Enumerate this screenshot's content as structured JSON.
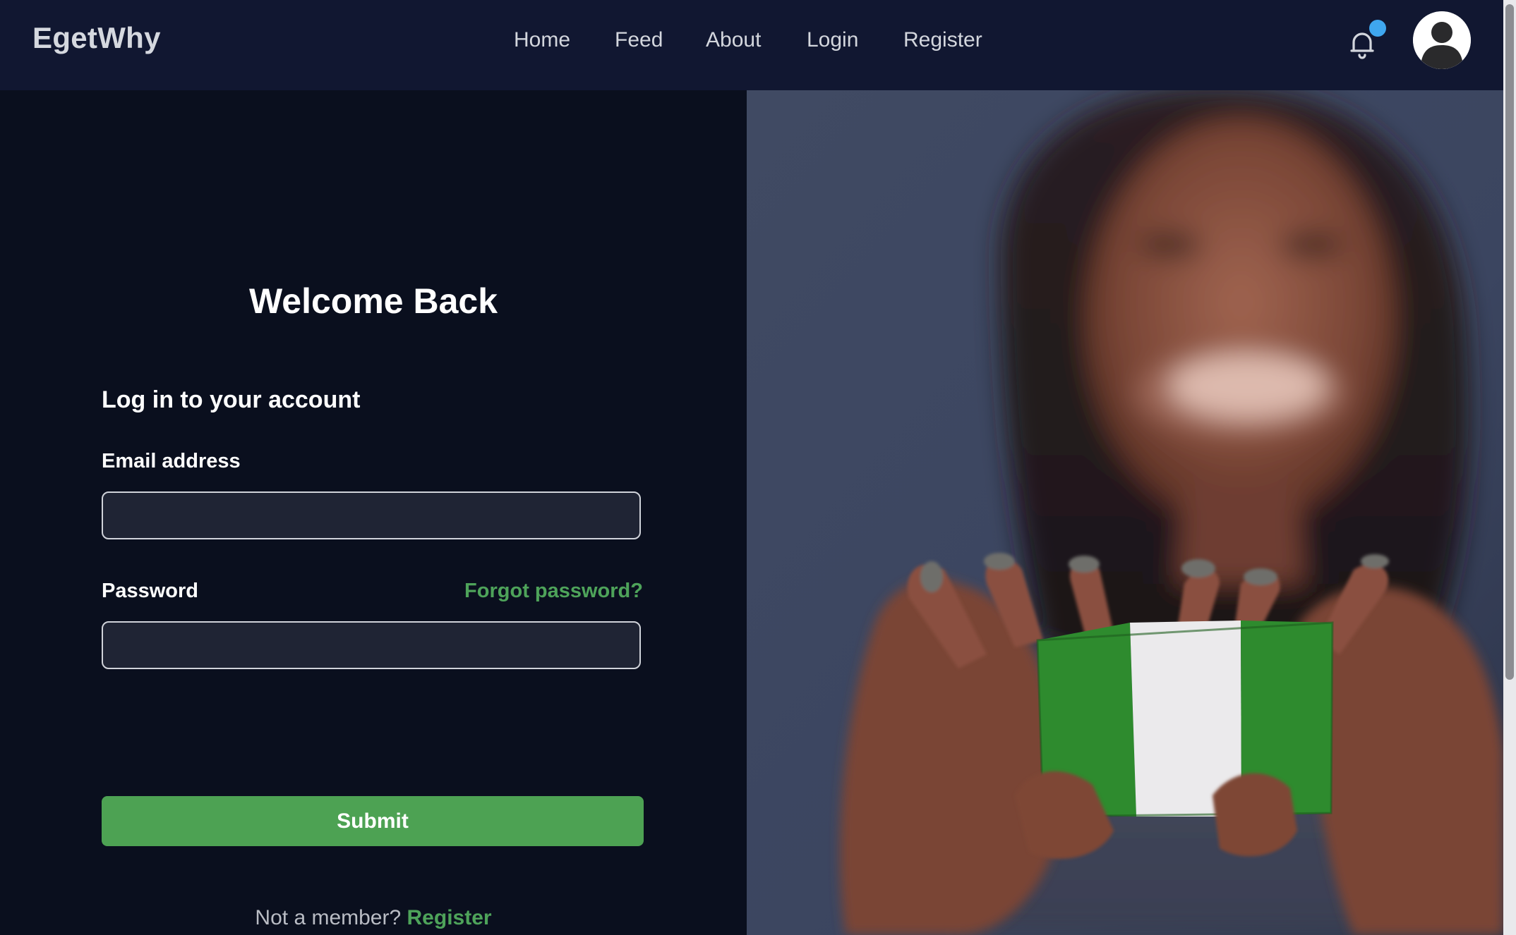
{
  "brand": "EgetWhy",
  "nav": {
    "home": "Home",
    "feed": "Feed",
    "about": "About",
    "login": "Login",
    "register": "Register"
  },
  "icons": {
    "notifications": "bell-icon",
    "notification_dot": "notification-dot",
    "profile": "user-avatar-icon"
  },
  "login": {
    "heading": "Welcome Back",
    "subtitle": "Log in to your account",
    "email_label": "Email address",
    "email_value": "",
    "password_label": "Password",
    "password_value": "",
    "forgot": "Forgot password?",
    "submit": "Submit",
    "not_member": "Not a member?",
    "register_link": "Register"
  },
  "colors": {
    "accent_green": "#4da253",
    "nav_bg": "#111731",
    "page_bg": "#0a0f1e",
    "notification_dot": "#3fa7ef"
  }
}
